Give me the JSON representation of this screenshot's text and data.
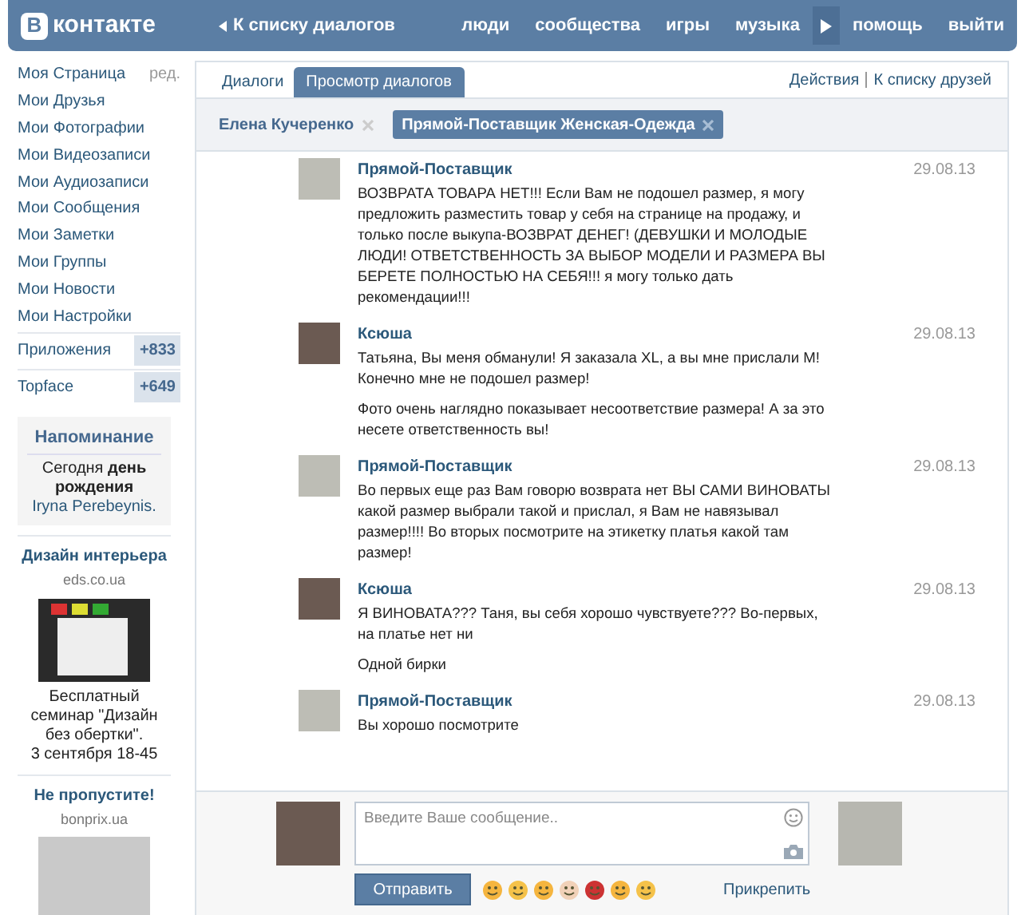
{
  "header": {
    "logo_letter": "В",
    "logo_text": "контакте",
    "back_link": "К списку диалогов",
    "nav": [
      "люди",
      "сообщества",
      "игры",
      "музыка"
    ],
    "nav_right": [
      "помощь",
      "выйти"
    ]
  },
  "sidebar": {
    "items": [
      {
        "label": "Моя Страница",
        "extra": "ред."
      },
      {
        "label": "Мои Друзья"
      },
      {
        "label": "Мои Фотографии"
      },
      {
        "label": "Мои Видеозаписи"
      },
      {
        "label": "Мои Аудиозаписи"
      },
      {
        "label": "Мои Сообщения"
      },
      {
        "label": "Мои Заметки"
      },
      {
        "label": "Мои Группы"
      },
      {
        "label": "Мои Новости"
      },
      {
        "label": "Мои Настройки"
      }
    ],
    "apps": [
      {
        "label": "Приложения",
        "count": "+833"
      },
      {
        "label": "Topface",
        "count": "+649"
      }
    ],
    "reminder": {
      "title": "Напоминание",
      "text": "Сегодня **день рождения**",
      "link": "Iryna Perebeynis."
    },
    "ads": [
      {
        "title": "Дизайн интерьера",
        "domain": "eds.co.ua",
        "text": "Бесплатный семинар \"Дизайн без обертки\".\n3 сентября 18-45",
        "kind": "logo"
      },
      {
        "title": "Не пропустите!",
        "domain": "bonprix.ua",
        "kind": "photo"
      }
    ]
  },
  "tabs": [
    {
      "label": "Диалоги",
      "selected": false
    },
    {
      "label": "Просмотр диалогов",
      "selected": true
    }
  ],
  "actions": [
    "Действия",
    "К списку друзей"
  ],
  "chips": [
    {
      "label": "Елена Кучеренко",
      "selected": false
    },
    {
      "label": "Прямой-Поставщик Женская-Одежда",
      "selected": true
    }
  ],
  "messages": [
    {
      "author": "Прямой-Поставщик",
      "date": "29.08.13",
      "paragraphs": [
        "ВОЗВРАТА ТОВАРА НЕТ!!! Если Вам не подошел размер, я могу предложить разместить товар у себя на странице на продажу, и только после выкупа-ВОЗВРАТ ДЕНЕГ! (ДЕВУШКИ И МОЛОДЫЕ ЛЮДИ! ОТВЕТСТВЕННОСТЬ ЗА ВЫБОР МОДЕЛИ И РАЗМЕРА ВЫ БЕРЕТЕ ПОЛНОСТЬЮ НА СЕБЯ!!! я могу только дать рекомендации!!!"
      ]
    },
    {
      "author": "Ксюша",
      "date": "29.08.13",
      "paragraphs": [
        "Татьяна, Вы меня обманули! Я заказала XL, а вы мне прислали М! Конечно мне не подошел размер!",
        "Фото очень наглядно показывает несоответствие размера! А за это несете ответственность вы!"
      ]
    },
    {
      "author": "Прямой-Поставщик",
      "date": "29.08.13",
      "paragraphs": [
        "Во первых еще раз Вам говорю возврата нет ВЫ САМИ ВИНОВАТЫ какой размер выбрали такой и прислал, я Вам не навязывал размер!!!! Во вторых посмотрите на этикетку платья какой там размер!"
      ]
    },
    {
      "author": "Ксюша",
      "date": "29.08.13",
      "paragraphs": [
        "Я ВИНОВАТА??? Таня, вы себя хорошо чувствуете??? Во-первых, на платье нет ни",
        "Одной бирки"
      ]
    },
    {
      "author": "Прямой-Поставщик",
      "date": "29.08.13",
      "paragraphs": [
        "Вы хорошо посмотрите"
      ]
    }
  ],
  "composer": {
    "placeholder": "Введите Ваше сообщение..",
    "send": "Отправить",
    "attach": "Прикрепить"
  }
}
